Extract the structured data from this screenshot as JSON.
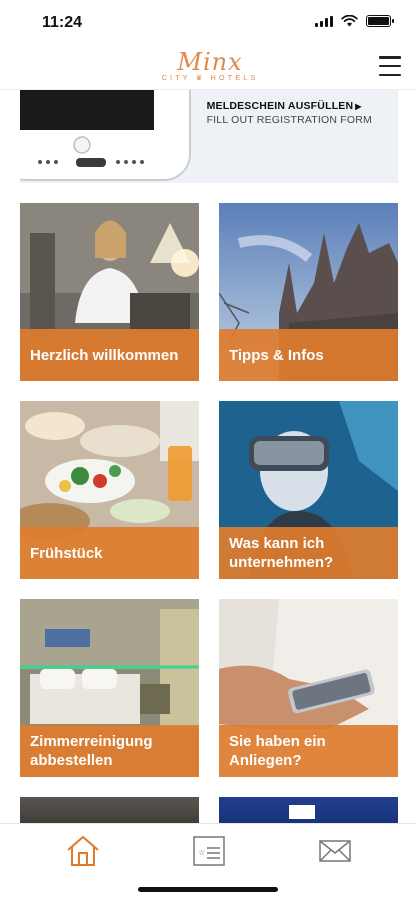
{
  "status_bar": {
    "time": "11:24"
  },
  "header": {
    "logo_script": "Minx",
    "logo_sub": "CITY ♛ HOTELS"
  },
  "registration": {
    "title": "MELDESCHEIN AUSFÜLLEN",
    "subtitle": "FILL OUT REGISTRATION FORM"
  },
  "tiles": [
    {
      "label": "Herzlich willkommen"
    },
    {
      "label": "Tipps & Infos"
    },
    {
      "label": "Frühstück"
    },
    {
      "label": "Was kann ich unternehmen?"
    },
    {
      "label": "Zimmerreinigung abbestellen"
    },
    {
      "label": "Sie haben ein Anliegen?"
    }
  ],
  "tab_bar": {
    "items": [
      "home-icon",
      "guest-card-icon",
      "mail-icon"
    ],
    "active": "home-icon"
  },
  "colors": {
    "accent": "#e07b2e",
    "tile_overlay": "#de7c2e",
    "logo": "#e08a4a"
  }
}
